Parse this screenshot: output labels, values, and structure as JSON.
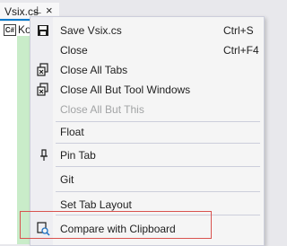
{
  "tab": {
    "title": "Vsix.cs",
    "pin_glyph": "⊥",
    "close_glyph": "×"
  },
  "editor": {
    "file_badge": "C#",
    "file_label": "Ko"
  },
  "menu": {
    "items": [
      {
        "label": "Save Vsix.cs",
        "shortcut": "Ctrl+S",
        "icon": "save-icon",
        "disabled": false
      },
      {
        "label": "Close",
        "shortcut": "Ctrl+F4",
        "icon": "",
        "disabled": false
      },
      {
        "label": "Close All Tabs",
        "shortcut": "",
        "icon": "close-all-tabs-icon",
        "disabled": false
      },
      {
        "label": "Close All But Tool Windows",
        "shortcut": "",
        "icon": "close-all-but-tool-windows-icon",
        "disabled": false
      },
      {
        "label": "Close All But This",
        "shortcut": "",
        "icon": "",
        "disabled": true
      },
      {
        "label": "Float",
        "shortcut": "",
        "icon": "",
        "disabled": false
      },
      {
        "label": "Pin Tab",
        "shortcut": "",
        "icon": "pin-icon",
        "disabled": false
      },
      {
        "label": "Git",
        "shortcut": "",
        "icon": "",
        "disabled": false
      },
      {
        "label": "Set Tab Layout",
        "shortcut": "",
        "icon": "",
        "disabled": false
      },
      {
        "label": "Compare with Clipboard",
        "shortcut": "",
        "icon": "compare-icon",
        "disabled": false
      }
    ]
  },
  "colors": {
    "accent": "#007acc",
    "highlight_border": "#d9534f",
    "disabled_text": "#a2a4a5"
  }
}
